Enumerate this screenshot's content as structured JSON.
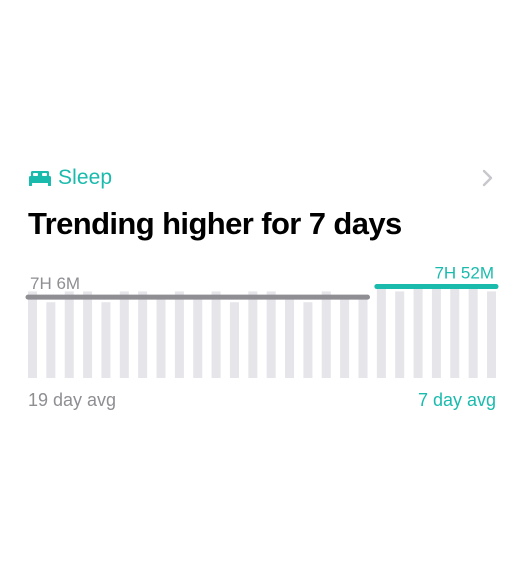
{
  "header": {
    "category": "Sleep",
    "category_icon": "bed-icon",
    "chevron_icon": "chevron-right-icon"
  },
  "title": "Trending higher for 7 days",
  "colors": {
    "accent": "#1ABBAD",
    "avg_line": "#8E8E93",
    "bar": "#E5E5EA",
    "muted_text": "#8E8E93",
    "chevron": "#C7C7CC"
  },
  "chart_data": {
    "type": "bar",
    "values": [
      8,
      7,
      8,
      8,
      7,
      8,
      8,
      7.5,
      8,
      7.5,
      8,
      7,
      8,
      8,
      7.5,
      7,
      8,
      7.5,
      7.5,
      8.5,
      8,
      8.5,
      8.5,
      8.5,
      8.5,
      8
    ],
    "periods": [
      {
        "name": "19 day avg",
        "value_label": "7H 6M",
        "start": 0,
        "count": 19
      },
      {
        "name": "7 day avg",
        "value_label": "7H 52M",
        "start": 19,
        "count": 7
      }
    ]
  }
}
